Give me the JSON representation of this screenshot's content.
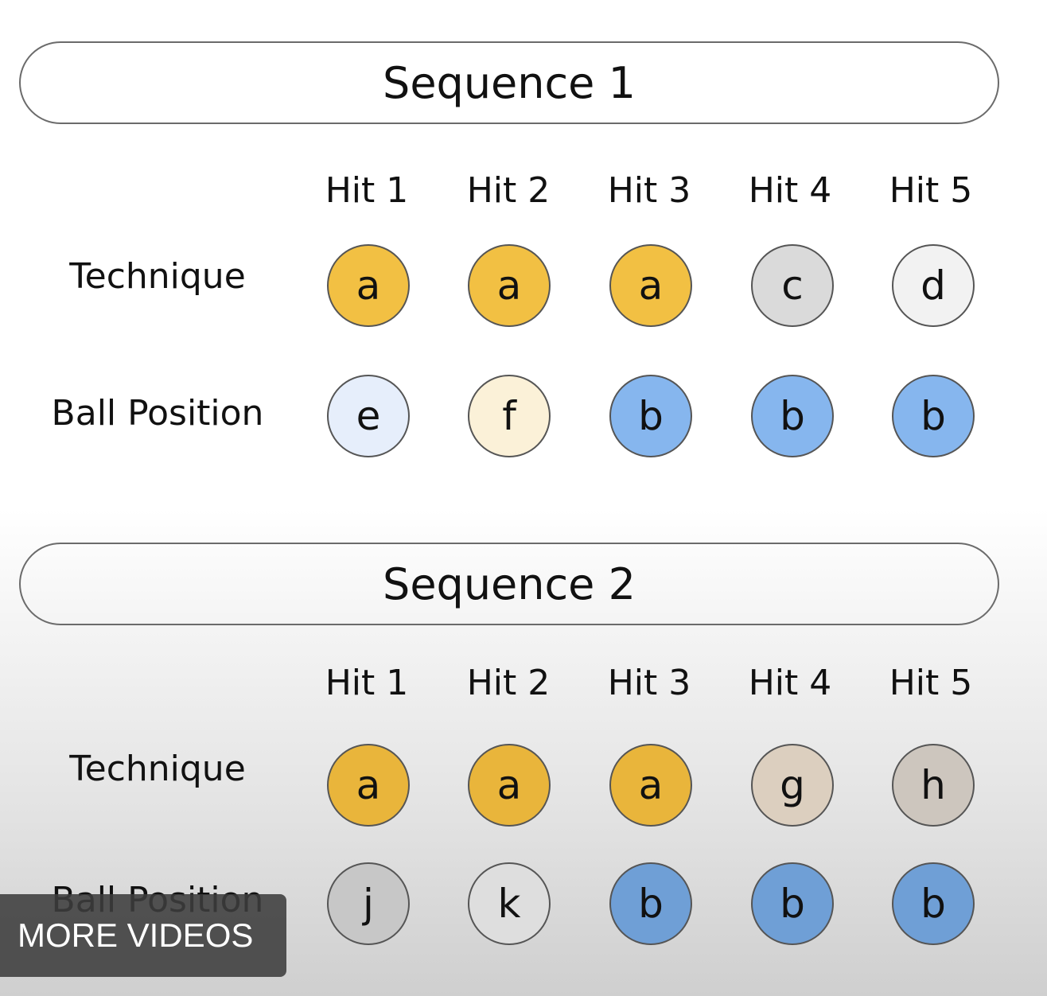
{
  "sequences": [
    {
      "title": "Sequence 1",
      "hits": [
        "Hit 1",
        "Hit 2",
        "Hit 3",
        "Hit 4",
        "Hit 5"
      ],
      "technique_label": "Technique",
      "ball_label": "Ball Position",
      "technique": [
        {
          "letter": "a",
          "color": "#f2c043"
        },
        {
          "letter": "a",
          "color": "#f2c043"
        },
        {
          "letter": "a",
          "color": "#f2c043"
        },
        {
          "letter": "c",
          "color": "#dadada"
        },
        {
          "letter": "d",
          "color": "#f2f2f2"
        }
      ],
      "ball": [
        {
          "letter": "e",
          "color": "#e6eefb"
        },
        {
          "letter": "f",
          "color": "#fbf1d8"
        },
        {
          "letter": "b",
          "color": "#86b6ee"
        },
        {
          "letter": "b",
          "color": "#86b6ee"
        },
        {
          "letter": "b",
          "color": "#86b6ee"
        }
      ]
    },
    {
      "title": "Sequence 2",
      "hits": [
        "Hit 1",
        "Hit 2",
        "Hit 3",
        "Hit 4",
        "Hit 5"
      ],
      "technique_label": "Technique",
      "ball_label": "Ball Position",
      "technique": [
        {
          "letter": "a",
          "color": "#e9b53b"
        },
        {
          "letter": "a",
          "color": "#e9b53b"
        },
        {
          "letter": "a",
          "color": "#e9b53b"
        },
        {
          "letter": "g",
          "color": "#dccfbf"
        },
        {
          "letter": "h",
          "color": "#cdc6be"
        }
      ],
      "ball": [
        {
          "letter": "j",
          "color": "#c7c7c7"
        },
        {
          "letter": "k",
          "color": "#dedede"
        },
        {
          "letter": "b",
          "color": "#6f9fd6"
        },
        {
          "letter": "b",
          "color": "#6f9fd6"
        },
        {
          "letter": "b",
          "color": "#6f9fd6"
        }
      ]
    }
  ],
  "overlay": {
    "label": "MORE VIDEOS"
  }
}
